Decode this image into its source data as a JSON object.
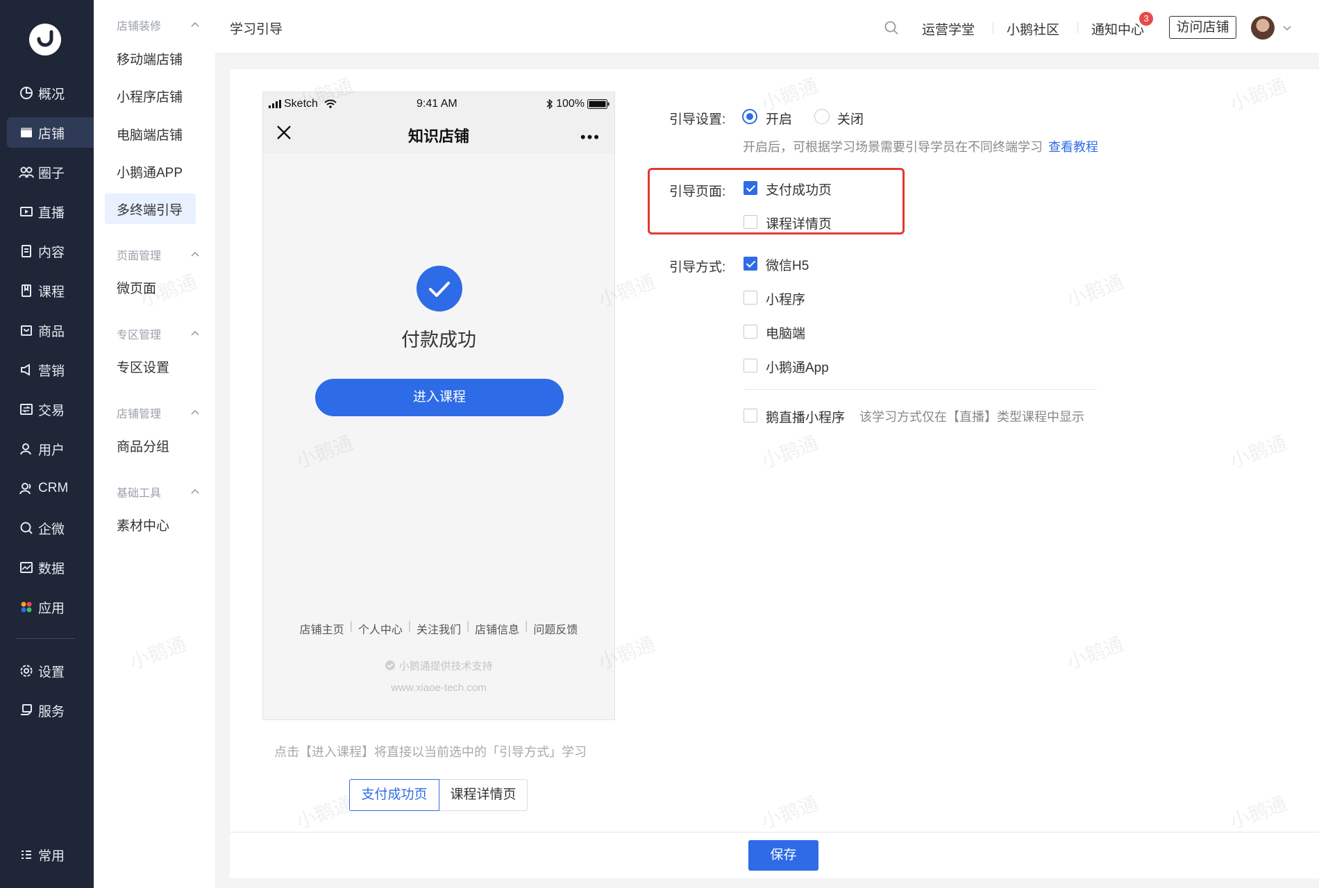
{
  "nav": {
    "items": [
      {
        "label": "概况",
        "icon": "pie-chart-icon"
      },
      {
        "label": "店铺",
        "icon": "store-icon"
      },
      {
        "label": "圈子",
        "icon": "group-icon"
      },
      {
        "label": "直播",
        "icon": "live-icon"
      },
      {
        "label": "内容",
        "icon": "document-icon"
      },
      {
        "label": "课程",
        "icon": "bookmark-icon"
      },
      {
        "label": "商品",
        "icon": "goods-icon"
      },
      {
        "label": "营销",
        "icon": "megaphone-icon"
      },
      {
        "label": "交易",
        "icon": "transaction-icon"
      },
      {
        "label": "用户",
        "icon": "user-icon"
      },
      {
        "label": "CRM",
        "icon": "crm-icon"
      },
      {
        "label": "企微",
        "icon": "wecom-icon"
      },
      {
        "label": "数据",
        "icon": "data-icon"
      },
      {
        "label": "应用",
        "icon": "apps-icon"
      },
      {
        "label": "设置",
        "icon": "gear-icon"
      },
      {
        "label": "服务",
        "icon": "service-icon"
      }
    ],
    "active": "店铺",
    "bottom_label": "常用"
  },
  "submenu": {
    "groups": [
      {
        "title": "店铺装修",
        "items": [
          "移动端店铺",
          "小程序店铺",
          "电脑端店铺",
          "小鹅通APP",
          "多终端引导"
        ]
      },
      {
        "title": "页面管理",
        "items": [
          "微页面"
        ]
      },
      {
        "title": "专区管理",
        "items": [
          "专区设置"
        ]
      },
      {
        "title": "店铺管理",
        "items": [
          "商品分组"
        ]
      },
      {
        "title": "基础工具",
        "items": [
          "素材中心"
        ]
      }
    ],
    "active": "多终端引导"
  },
  "header": {
    "title": "学习引导",
    "links": [
      "运营学堂",
      "小鹅社区",
      "通知中心"
    ],
    "notification_count": "3",
    "visit_button": "访问店铺"
  },
  "phone": {
    "carrier": "Sketch",
    "time": "9:41 AM",
    "battery": "100%",
    "title": "知识店铺",
    "more": "•••",
    "success_text": "付款成功",
    "enter_button": "进入课程",
    "footer_links": [
      "店铺主页",
      "个人中心",
      "关注我们",
      "店铺信息",
      "问题反馈"
    ],
    "tech_support": "小鹅通提供技术支持",
    "tech_url": "www.xiaoe-tech.com"
  },
  "preview": {
    "hint": "点击【进入课程】将直接以当前选中的「引导方式」学习",
    "tabs": [
      "支付成功页",
      "课程详情页"
    ],
    "active_tab": "支付成功页"
  },
  "form": {
    "guide_setting": {
      "label": "引导设置:",
      "options": [
        "开启",
        "关闭"
      ],
      "selected": "开启",
      "hint": "开启后，可根据学习场景需要引导学员在不同终端学习",
      "hint_link": "查看教程"
    },
    "guide_page": {
      "label": "引导页面:",
      "options": [
        {
          "label": "支付成功页",
          "checked": true
        },
        {
          "label": "课程详情页",
          "checked": false
        }
      ]
    },
    "guide_method": {
      "label": "引导方式:",
      "options": [
        {
          "label": "微信H5",
          "checked": true
        },
        {
          "label": "小程序",
          "checked": false
        },
        {
          "label": "电脑端",
          "checked": false
        },
        {
          "label": "小鹅通App",
          "checked": false
        }
      ],
      "extra": {
        "label": "鹅直播小程序",
        "checked": false,
        "note": "该学习方式仅在【直播】类型课程中显示"
      }
    }
  },
  "save_button": "保存",
  "watermark_text": "小鹅通",
  "colors": {
    "primary": "#2e6be6",
    "nav_bg": "#1f2638",
    "highlight": "#e03a2f"
  }
}
